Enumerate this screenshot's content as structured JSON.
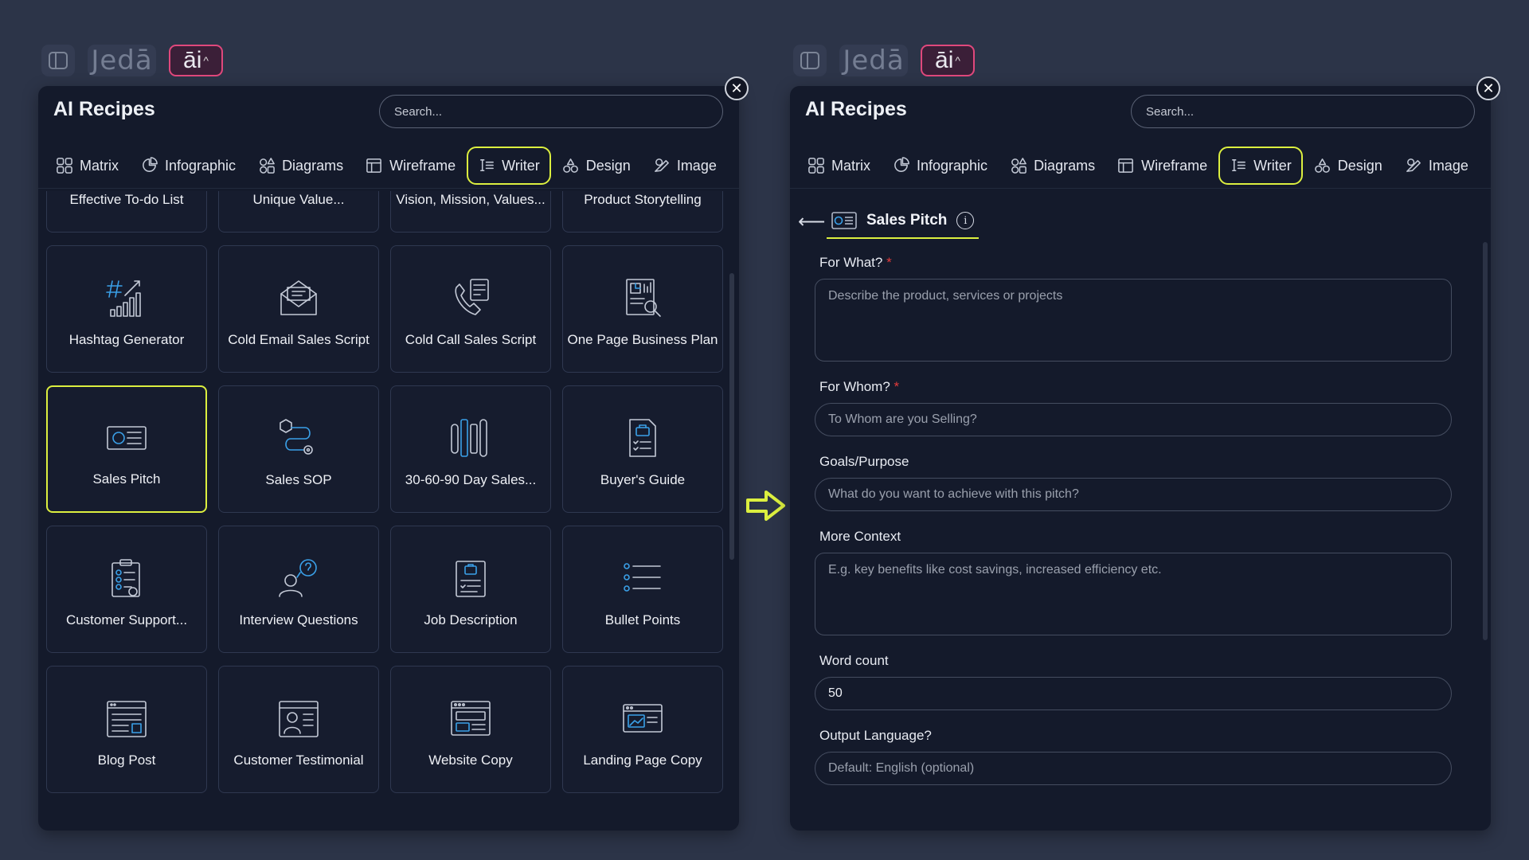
{
  "brand": {
    "logo": "Jedā",
    "ai_label": "āi"
  },
  "left_panel": {
    "title": "AI Recipes",
    "search_placeholder": "Search...",
    "tabs": [
      {
        "label": "Matrix",
        "icon": "matrix-icon"
      },
      {
        "label": "Infographic",
        "icon": "infographic-icon"
      },
      {
        "label": "Diagrams",
        "icon": "diagrams-icon"
      },
      {
        "label": "Wireframe",
        "icon": "wireframe-icon"
      },
      {
        "label": "Writer",
        "icon": "writer-icon",
        "active": true
      },
      {
        "label": "Design",
        "icon": "design-icon"
      },
      {
        "label": "Image",
        "icon": "image-icon"
      }
    ],
    "recipes": [
      {
        "label": "Effective To-do List",
        "icon": "todo-clipboard-icon"
      },
      {
        "label": "Unique Value...",
        "icon": "unique-value-icon"
      },
      {
        "label": "Vision, Mission, Values...",
        "icon": "text-lines-icon"
      },
      {
        "label": "Product Storytelling",
        "icon": "storyboard-icon"
      },
      {
        "label": "Hashtag Generator",
        "icon": "hashtag-chart-icon"
      },
      {
        "label": "Cold Email Sales Script",
        "icon": "envelope-icon"
      },
      {
        "label": "Cold Call Sales Script",
        "icon": "phone-script-icon"
      },
      {
        "label": "One Page Business Plan",
        "icon": "business-plan-icon"
      },
      {
        "label": "Sales Pitch",
        "icon": "sales-pitch-icon",
        "selected": true
      },
      {
        "label": "Sales SOP",
        "icon": "sales-sop-icon"
      },
      {
        "label": "30-60-90 Day Sales...",
        "icon": "timeline-icon"
      },
      {
        "label": "Buyer's Guide",
        "icon": "buyers-guide-icon"
      },
      {
        "label": "Customer Support...",
        "icon": "support-clipboard-icon"
      },
      {
        "label": "Interview Questions",
        "icon": "interview-icon"
      },
      {
        "label": "Job Description",
        "icon": "job-description-icon"
      },
      {
        "label": "Bullet Points",
        "icon": "bullet-list-icon"
      },
      {
        "label": "Blog Post",
        "icon": "blog-post-icon"
      },
      {
        "label": "Customer Testimonial",
        "icon": "testimonial-icon"
      },
      {
        "label": "Website Copy",
        "icon": "website-icon"
      },
      {
        "label": "Landing Page Copy",
        "icon": "landing-page-icon"
      }
    ]
  },
  "right_panel": {
    "title": "AI Recipes",
    "search_placeholder": "Search...",
    "active_recipe": "Sales Pitch",
    "fields": [
      {
        "label": "For What?",
        "required": true,
        "type": "area",
        "placeholder": "Describe the product, services or projects",
        "value": ""
      },
      {
        "label": "For Whom?",
        "required": true,
        "type": "pill",
        "placeholder": "To Whom are you Selling?",
        "value": ""
      },
      {
        "label": "Goals/Purpose",
        "required": false,
        "type": "pill",
        "placeholder": "What do you want to achieve with this pitch?",
        "value": ""
      },
      {
        "label": "More Context",
        "required": false,
        "type": "area",
        "placeholder": "E.g. key benefits like cost savings, increased efficiency etc.",
        "value": ""
      },
      {
        "label": "Word count",
        "required": false,
        "type": "pill",
        "placeholder": "",
        "value": "50"
      },
      {
        "label": "Output Language?",
        "required": false,
        "type": "pill",
        "placeholder": "Default: English (optional)",
        "value": ""
      }
    ]
  },
  "colors": {
    "accent": "#dcef3f",
    "ai_badge": "#e0487c",
    "icon_blue": "#3aa0e8",
    "required": "#e53b3b",
    "arrow": "#dcef3f"
  }
}
